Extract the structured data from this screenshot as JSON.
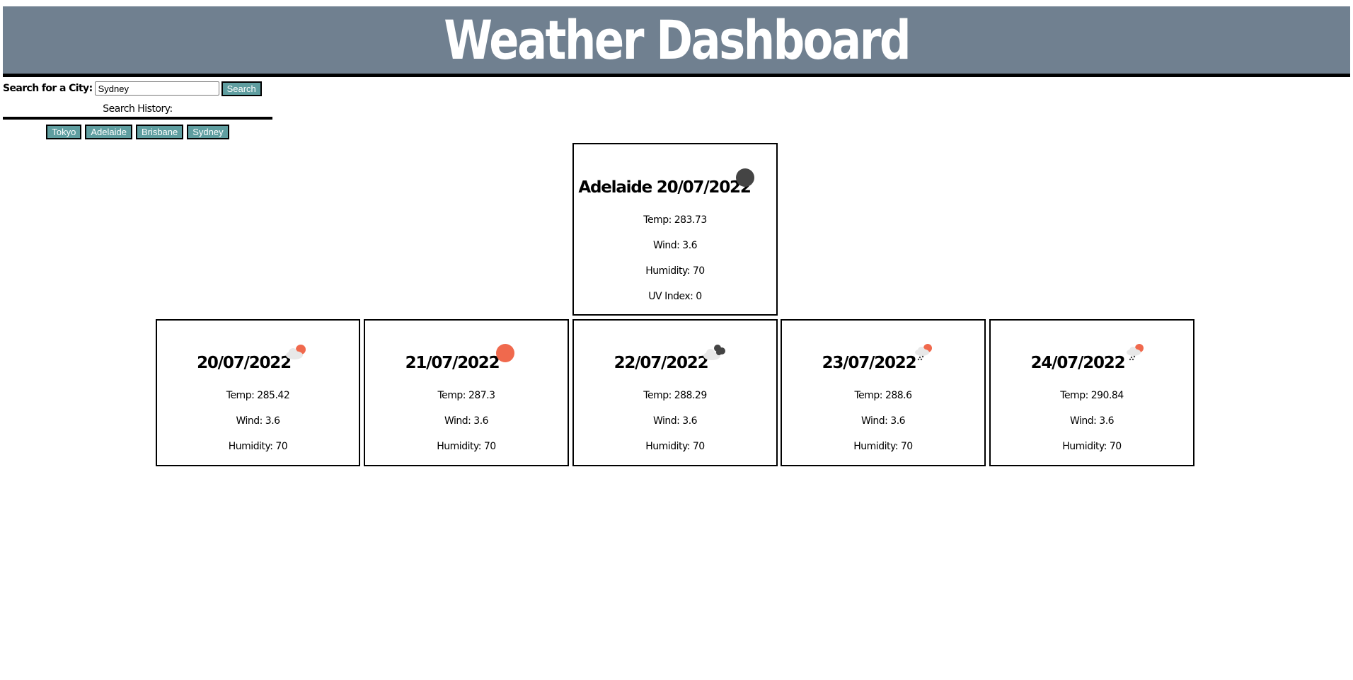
{
  "header": {
    "title": "Weather Dashboard"
  },
  "search": {
    "label": "Search for a City:",
    "value": "Sydney",
    "button_label": "Search"
  },
  "history": {
    "title": "Search History:",
    "items": [
      "Tokyo",
      "Adelaide",
      "Brisbane",
      "Sydney"
    ]
  },
  "current": {
    "city": "Adelaide",
    "date": "20/07/2022",
    "heading": "Adelaide 20/07/2022",
    "icon": "dark-circle-icon",
    "temp": "Temp: 283.73",
    "wind": "Wind: 3.6",
    "humidity": "Humidity: 70",
    "uv": "UV Index: 0"
  },
  "forecast": [
    {
      "date": "20/07/2022",
      "icon": "cloud-sun-icon",
      "temp": "Temp: 285.42",
      "wind": "Wind: 3.6",
      "humidity": "Humidity: 70"
    },
    {
      "date": "21/07/2022",
      "icon": "sun-icon",
      "temp": "Temp: 287.3",
      "wind": "Wind: 3.6",
      "humidity": "Humidity: 70"
    },
    {
      "date": "22/07/2022",
      "icon": "dark-clouds-icon",
      "temp": "Temp: 288.29",
      "wind": "Wind: 3.6",
      "humidity": "Humidity: 70"
    },
    {
      "date": "23/07/2022",
      "icon": "cloud-sun-rain-icon",
      "temp": "Temp: 288.6",
      "wind": "Wind: 3.6",
      "humidity": "Humidity: 70"
    },
    {
      "date": "24/07/2022",
      "icon": "cloud-sun-rain-icon",
      "temp": "Temp: 290.84",
      "wind": "Wind: 3.6",
      "humidity": "Humidity: 70"
    }
  ],
  "colors": {
    "header_bg": "#708090",
    "button_bg": "#5f9ea0",
    "sun": "#f0694d",
    "dark": "#444444",
    "cloud": "#e8e8e8"
  }
}
